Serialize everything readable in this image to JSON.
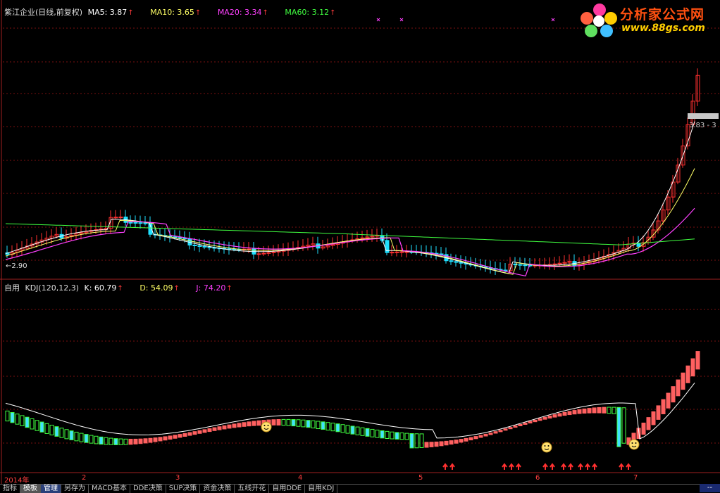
{
  "main_panel": {
    "title": "紫江企业(日线,前复权)",
    "ma5": "MA5: 3.87",
    "ma10": "MA10: 3.65",
    "ma20": "MA20: 3.34",
    "ma60": "MA60: 3.12",
    "left_low_label": "←2.90",
    "right_price_label": "3.83 - 3",
    "colors": {
      "ma5": "#ffffff",
      "ma10": "#ffff66",
      "ma20": "#ff40ff",
      "ma60": "#40ff40",
      "up": "#ff3030",
      "down": "#20e0ff"
    }
  },
  "indicator_panel": {
    "name": "自用",
    "params": "KDJ(120,12,3)",
    "k": "K: 60.79",
    "d": "D: 54.09",
    "j": "J: 74.20"
  },
  "x_axis": {
    "labels": [
      "2014年",
      "2",
      "3",
      "4",
      "5",
      "6",
      "7"
    ]
  },
  "tabs": [
    "指标",
    "模板",
    "管理",
    "另存为",
    "MACD基本",
    "DDE决策",
    "SUP决策",
    "资金决策",
    "五线开花",
    "自用DDE",
    "自用KDJ"
  ],
  "corner_button": "--",
  "logo": {
    "title": "分析家公式网",
    "url": "www.88gs.com"
  },
  "icons": [
    "up-arrow-icon",
    "smiley-icon",
    "cross-marker-icon",
    "flower-logo-icon"
  ]
}
